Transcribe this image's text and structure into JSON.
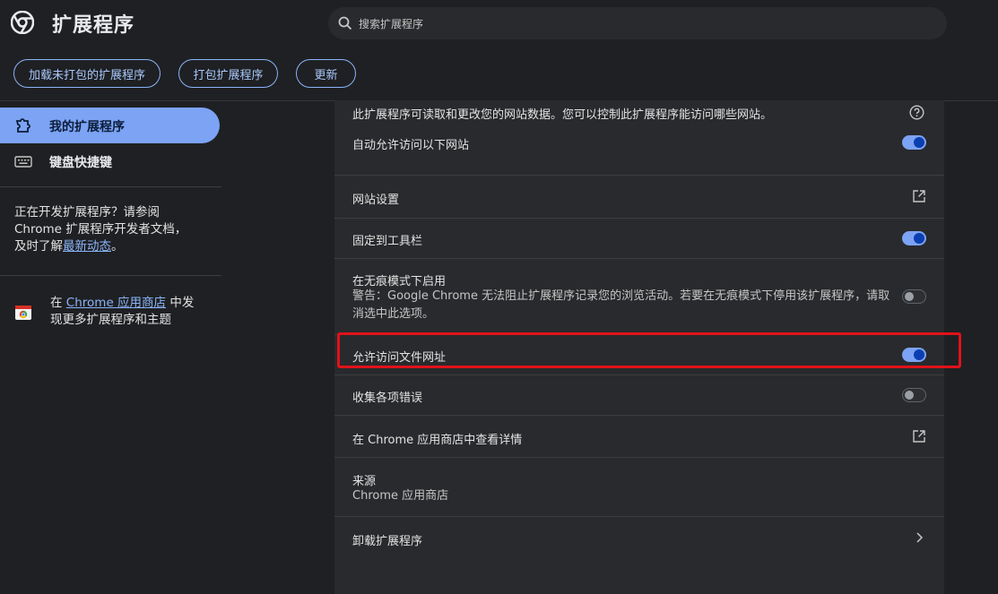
{
  "header": {
    "title": "扩展程序",
    "search_placeholder": "搜索扩展程序"
  },
  "toolbar": {
    "load_unpacked": "加载未打包的扩展程序",
    "pack": "打包扩展程序",
    "update": "更新"
  },
  "sidebar": {
    "items": [
      {
        "label": "我的扩展程序"
      },
      {
        "label": "键盘快捷键"
      }
    ],
    "dev_text_before": "正在开发扩展程序？请参阅 Chrome 扩展程序开发者文档，及时了解",
    "dev_link": "最新动态",
    "dev_text_after": "。",
    "store_prefix": "在 ",
    "store_link": "Chrome 应用商店",
    "store_suffix": " 中发现更多扩展程序和主题"
  },
  "details": {
    "site_access_desc": "此扩展程序可读取和更改您的网站数据。您可以控制此扩展程序能访问哪些网站。",
    "auto_allow": "自动允许访问以下网站",
    "auto_allow_on": true,
    "site_settings": "网站设置",
    "pin_toolbar": "固定到工具栏",
    "pin_toolbar_on": true,
    "incognito": "在无痕模式下启用",
    "incognito_warning": "警告：Google Chrome 无法阻止扩展程序记录您的浏览活动。若要在无痕模式下停用该扩展程序，请取消选中此选项。",
    "incognito_on": false,
    "file_urls": "允许访问文件网址",
    "file_urls_on": true,
    "collect_errors": "收集各项错误",
    "collect_errors_on": false,
    "view_in_store": "在 Chrome 应用商店中查看详情",
    "source_label": "来源",
    "source_value": "Chrome 应用商店",
    "remove": "卸载扩展程序"
  },
  "colors": {
    "accent": "#7ca3f4",
    "highlight": "#e0121a"
  }
}
